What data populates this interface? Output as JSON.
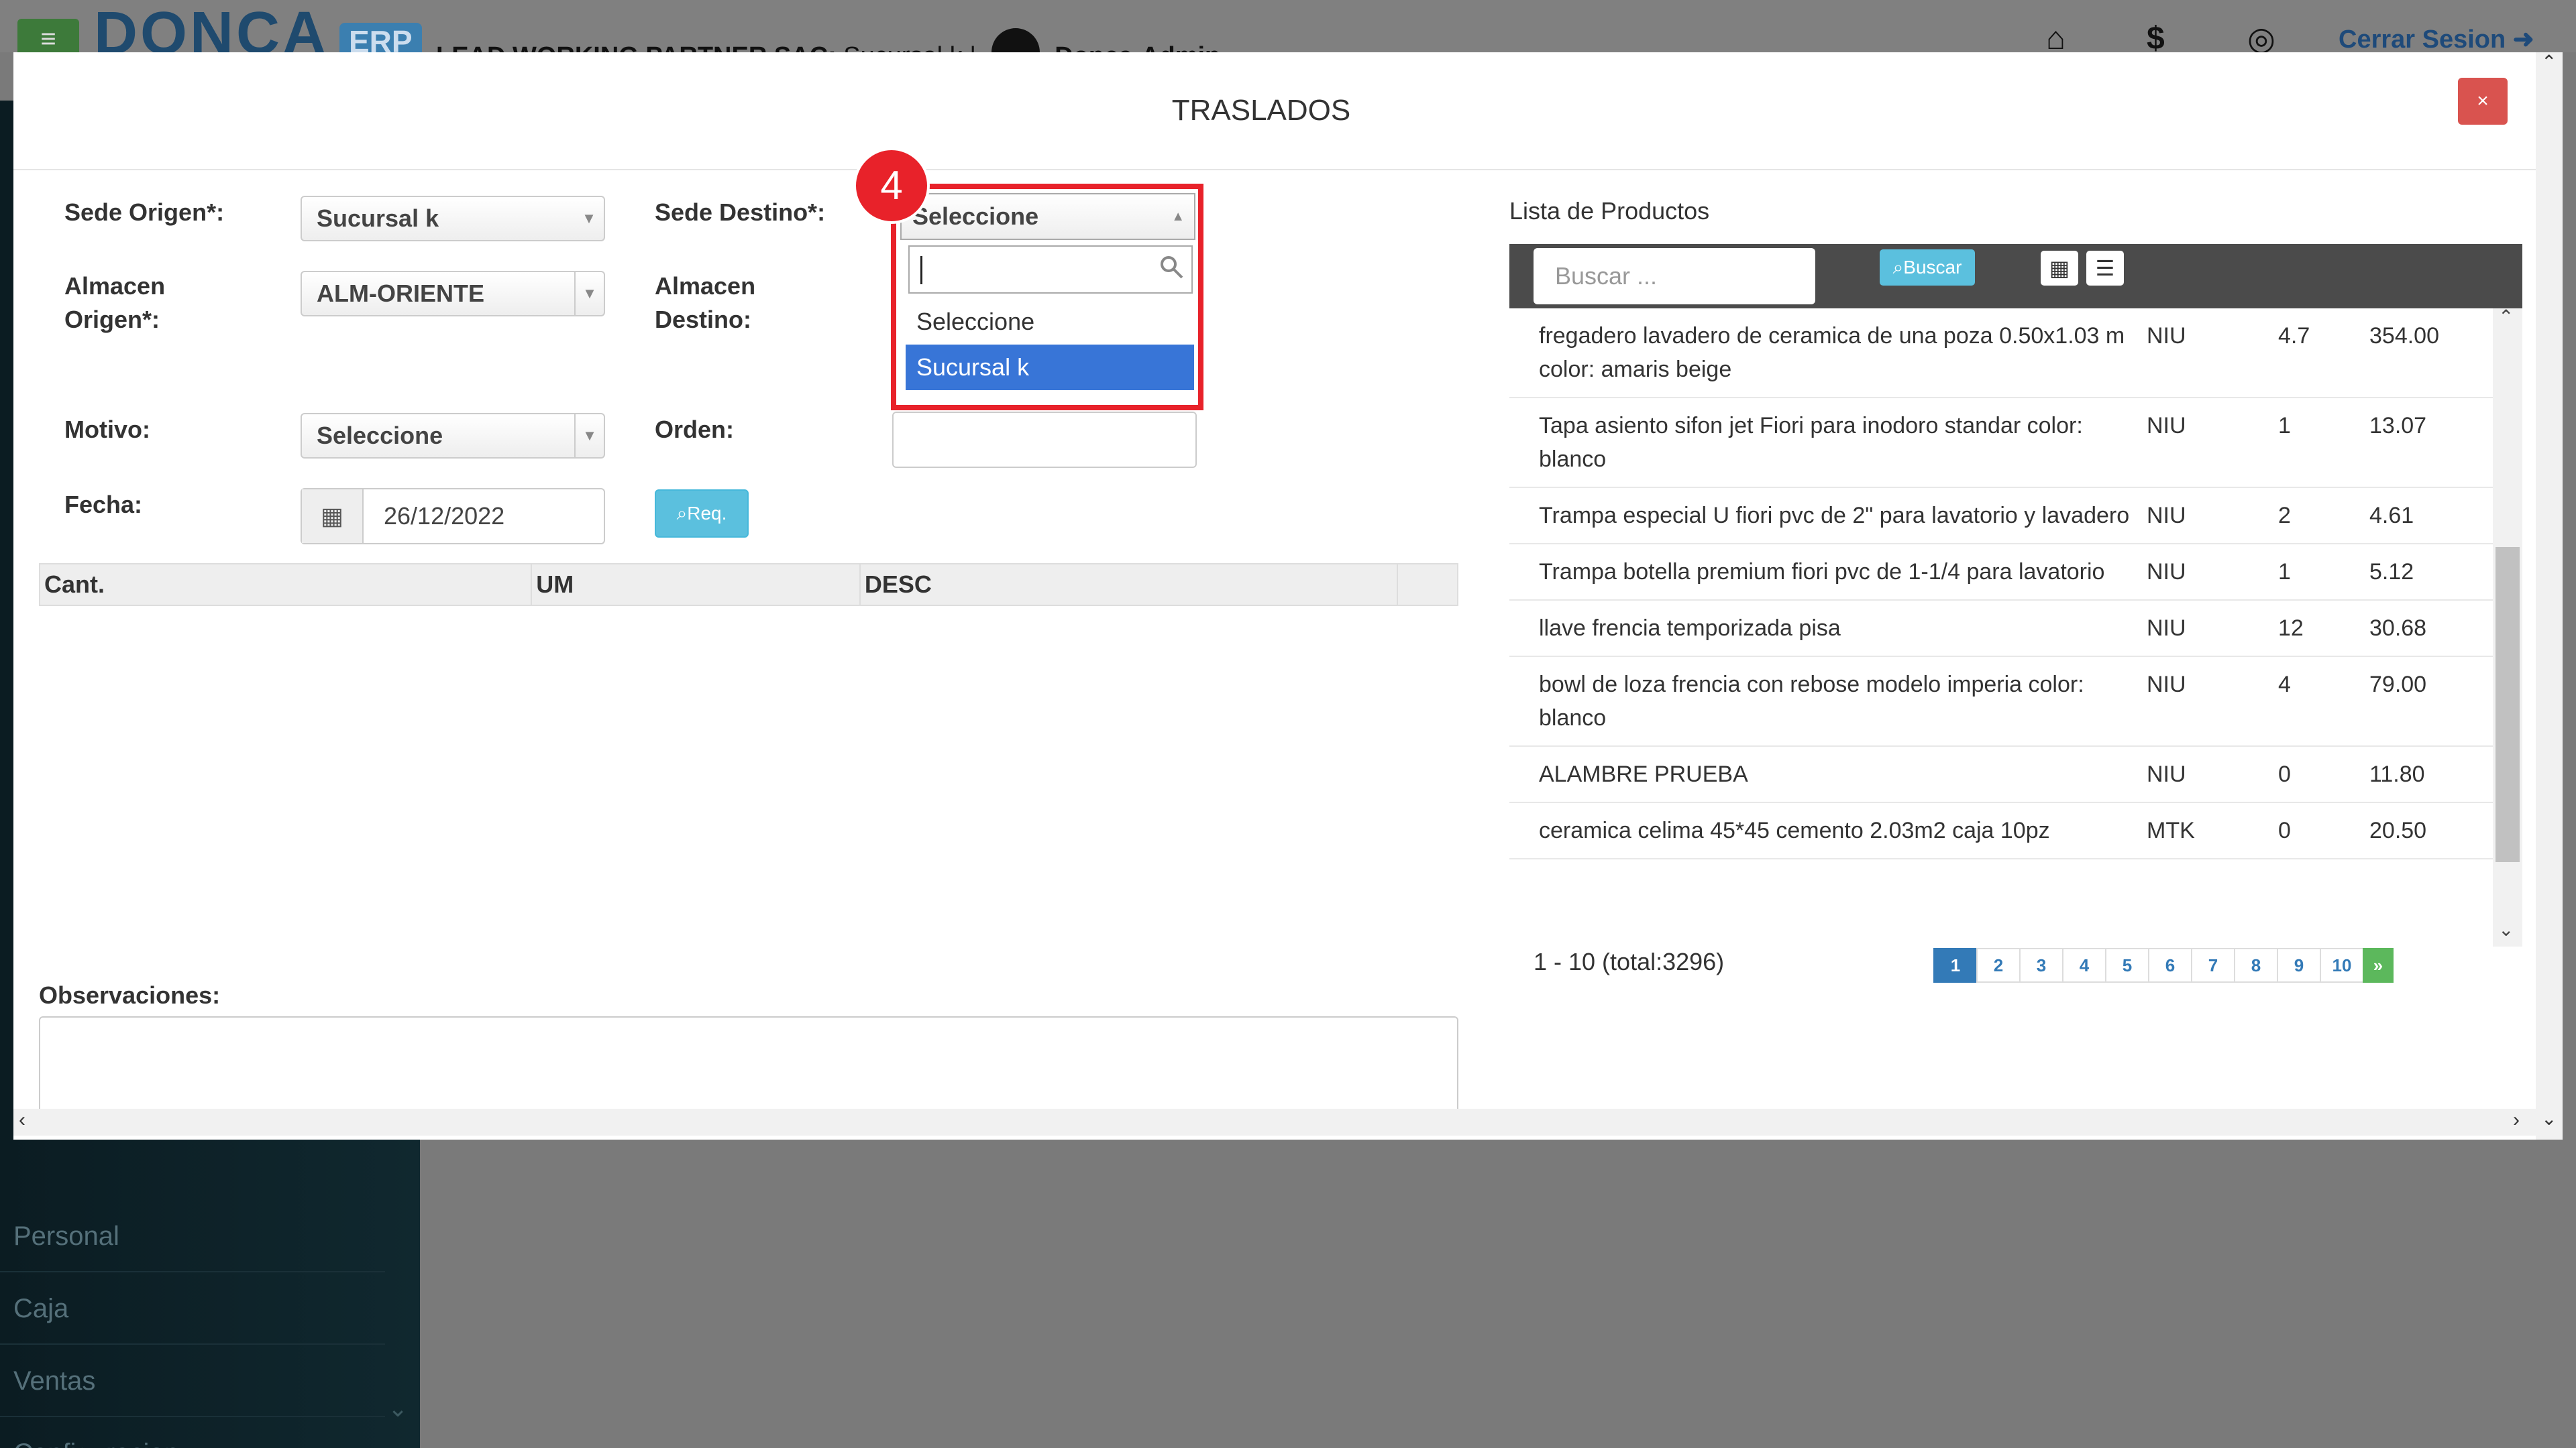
{
  "app": {
    "logo_text": "DONCA",
    "logo_badge": "ERP",
    "company": "LEAD WORKING PARTNER SAC:",
    "branch": "Sucursal k |",
    "user": "Donca-Admin -",
    "logout_label": "Cerrar Sesion",
    "menu_icon": "hamburger-icon"
  },
  "sidebar": {
    "items": [
      {
        "label": "Personal"
      },
      {
        "label": "Caja"
      },
      {
        "label": "Ventas"
      },
      {
        "label": "Configuracion"
      }
    ]
  },
  "modal": {
    "title": "TRASLADOS",
    "close_label": "×"
  },
  "form": {
    "sede_origen_label": "Sede Origen*:",
    "sede_origen_value": "Sucursal k",
    "almacen_origen_label_1": "Almacen",
    "almacen_origen_label_2": "Origen*:",
    "almacen_origen_value": "ALM-ORIENTE",
    "motivo_label": "Motivo:",
    "motivo_value": "Seleccione",
    "fecha_label": "Fecha:",
    "fecha_value": "26/12/2022",
    "req_label": "Req.",
    "sede_destino_label": "Sede Destino*:",
    "almacen_destino_label_1": "Almacen",
    "almacen_destino_label_2": "Destino:",
    "orden_label": "Orden:",
    "observaciones_label": "Observaciones:"
  },
  "dropdown": {
    "selected": "Seleccione",
    "search_value": "",
    "options": [
      {
        "label": "Seleccione",
        "active": false
      },
      {
        "label": "Sucursal k",
        "active": true
      }
    ],
    "step_badge": "4"
  },
  "detail_table": {
    "headers": [
      "Cant.",
      "UM",
      "DESC"
    ]
  },
  "products": {
    "title": "Lista de Productos",
    "search_placeholder": "Buscar ...",
    "search_button": "Buscar",
    "rows": [
      {
        "desc": "fregadero lavadero de ceramica de una poza 0.50x1.03 m color: amaris beige",
        "um": "NIU",
        "qty": "4.7",
        "price": "354.00"
      },
      {
        "desc": "Tapa asiento sifon jet Fiori para inodoro standar color: blanco",
        "um": "NIU",
        "qty": "1",
        "price": "13.07"
      },
      {
        "desc": "Trampa especial U fiori pvc de 2\" para lavatorio y lavadero",
        "um": "NIU",
        "qty": "2",
        "price": "4.61"
      },
      {
        "desc": "Trampa botella premium fiori pvc de 1-1/4 para lavatorio",
        "um": "NIU",
        "qty": "1",
        "price": "5.12"
      },
      {
        "desc": "llave frencia temporizada pisa",
        "um": "NIU",
        "qty": "12",
        "price": "30.68"
      },
      {
        "desc": "bowl de loza frencia con rebose modelo imperia color: blanco",
        "um": "NIU",
        "qty": "4",
        "price": "79.00"
      },
      {
        "desc": "ALAMBRE PRUEBA",
        "um": "NIU",
        "qty": "0",
        "price": "11.80"
      },
      {
        "desc": "ceramica celima 45*45 cemento 2.03m2 caja 10pz",
        "um": "MTK",
        "qty": "0",
        "price": "20.50"
      }
    ],
    "pager_info": "1 - 10 (total:3296)",
    "pages": [
      "1",
      "2",
      "3",
      "4",
      "5",
      "6",
      "7",
      "8",
      "9",
      "10"
    ],
    "next_label": "»"
  }
}
